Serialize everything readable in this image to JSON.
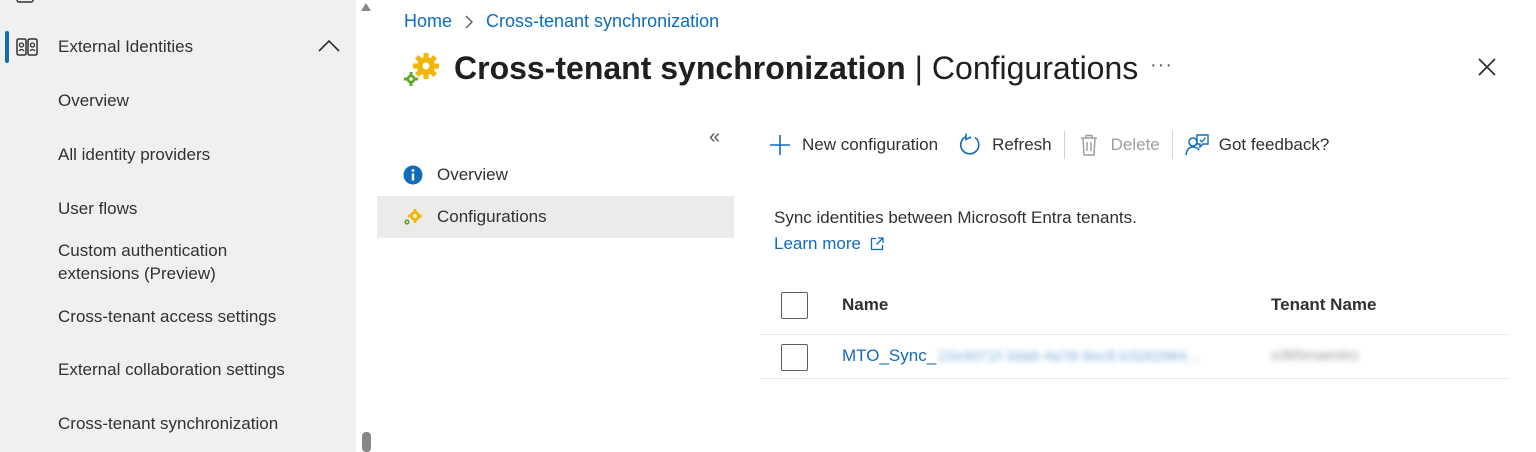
{
  "leftnav": {
    "external_identities": "External Identities",
    "items": [
      {
        "label": "Overview"
      },
      {
        "label": "All identity providers"
      },
      {
        "label": "User flows"
      },
      {
        "label": "Custom authentication extensions (Preview)"
      },
      {
        "label": "Cross-tenant access settings"
      },
      {
        "label": "External collaboration settings"
      },
      {
        "label": "Cross-tenant synchronization"
      }
    ]
  },
  "breadcrumb": {
    "home": "Home",
    "current": "Cross-tenant synchronization"
  },
  "header": {
    "title": "Cross-tenant synchronization",
    "separator": "|",
    "subtitle": "Configurations",
    "more": "···"
  },
  "resource_menu": {
    "collapse": "«",
    "items": [
      {
        "label": "Overview",
        "icon": "info-icon"
      },
      {
        "label": "Configurations",
        "icon": "gears-icon",
        "selected": true
      }
    ]
  },
  "toolbar": {
    "new_configuration": "New configuration",
    "refresh": "Refresh",
    "delete": "Delete",
    "feedback": "Got feedback?"
  },
  "content": {
    "description": "Sync identities between Microsoft Entra tenants.",
    "learn_more": "Learn more"
  },
  "grid": {
    "columns": [
      "Name",
      "Tenant Name"
    ],
    "rows": [
      {
        "name_prefix": "MTO_Sync_",
        "name_redacted": "22e9071f-3da6-4a78-9ec8-b3282984...",
        "tenant_redacted": "o365maestro"
      }
    ]
  },
  "colors": {
    "accent": "#0f6cbd",
    "nav_background": "#f0f0f0",
    "selected_background": "#edebe9",
    "gear_yellow": "#f2b700",
    "gear_green": "#5ea52a"
  }
}
